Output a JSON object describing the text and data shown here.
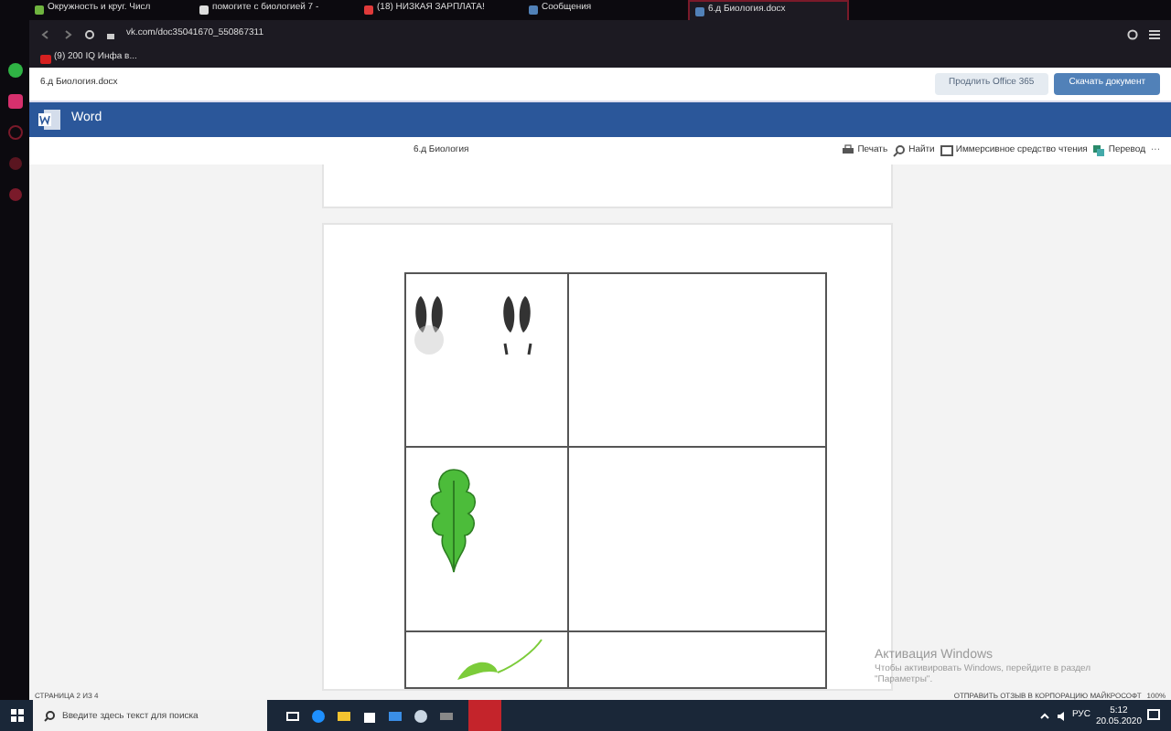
{
  "browser": {
    "tabs": [
      {
        "label": "Окружность и круг. Числ",
        "selected": false,
        "color": "#6fb43f"
      },
      {
        "label": "помогите с биологией 7 -",
        "selected": false,
        "color": "#dddddd"
      },
      {
        "label": "(18) НИЗКАЯ ЗАРПЛАТА!",
        "selected": false,
        "color": "#e03a3a"
      },
      {
        "label": "Сообщения",
        "selected": false,
        "color": "#5181b8"
      },
      {
        "label": "6.д Биология.docx",
        "selected": true,
        "color": "#5181b8"
      }
    ],
    "address": "vk.com/doc35041670_550867311",
    "bookmarks": [
      "(9) 200 IQ Инфа в..."
    ]
  },
  "vk_header": {
    "title": "6.д Биология.docx",
    "buttons": [
      {
        "label": "Продлить Office 365",
        "kind": "secondary"
      },
      {
        "label": "Скачать документ",
        "kind": "primary"
      }
    ]
  },
  "word": {
    "app_name": "Word",
    "doc_title": "6.д Биология",
    "toolbar": [
      {
        "label": "Печать",
        "kind": "print"
      },
      {
        "label": "Найти",
        "kind": "search"
      },
      {
        "label": "Иммерсивное средство чтения",
        "kind": "reader"
      },
      {
        "label": "Перевод",
        "kind": "translate"
      },
      {
        "label": "···",
        "kind": "more"
      }
    ],
    "status_bar": {
      "page": "СТРАНИЦА 2 ИЗ 4",
      "feedback": "ОТПРАВИТЬ ОТЗЫВ В КОРПОРАЦИЮ МАЙКРОСОФТ",
      "zoom": "100%"
    }
  },
  "activation": {
    "title": "Активация Windows",
    "text": "Чтобы активировать Windows, перейдите в раздел \"Параметры\"."
  },
  "taskbar": {
    "search_placeholder": "Введите здесь текст для поиска",
    "language": "РУС",
    "time": "5:12",
    "date": "20.05.2020"
  }
}
